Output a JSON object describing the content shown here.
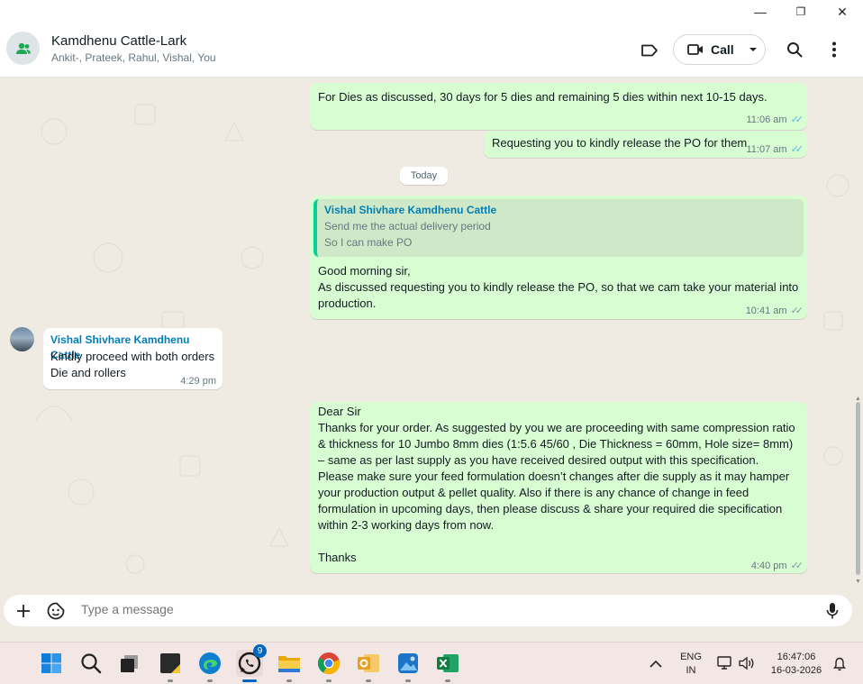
{
  "window": {
    "minimize_glyph": "—",
    "restore_glyph": "❐",
    "close_glyph": "✕"
  },
  "header": {
    "title": "Kamdhenu Cattle-Lark",
    "members": "Ankit-, Prateek, Rahul, Vishal, You",
    "call_label": "Call",
    "icons": [
      "group-icon",
      "label-icon",
      "video-icon",
      "search-icon",
      "more-icon"
    ]
  },
  "messages": [
    {
      "text": "For Dies as discussed, 30 days for 5 dies and remaining 5 dies within next 10-15 days.",
      "time": "11:06 am",
      "status": "read"
    },
    {
      "text": "Requesting you to kindly release the PO for them",
      "time": "11:07 am",
      "status": "read"
    },
    {
      "date_chip": "Today"
    },
    {
      "quote_author": "Vishal Shivhare Kamdhenu Cattle",
      "quote_line1": "Send me the actual delivery period",
      "quote_line2": "So I can make PO",
      "text": "Good morning sir,\nAs discussed requesting you to kindly release the PO, so  that we cam take your material into\nproduction.",
      "time": "10:41 am",
      "status": "delivered"
    },
    {
      "sender": "Vishal Shivhare Kamdhenu Cattle",
      "text": "Kindly proceed with both orders\nDie and rollers",
      "time": "4:29 pm"
    },
    {
      "text": "Dear Sir\nThanks for your order. As suggested by you we are proceeding with same compression ratio\n& thickness for 10 Jumbo 8mm dies (1:5.6   45/60 , Die Thickness =  60mm, Hole size= 8mm)\n– same as per last supply as you have received desired output with this specification.\nPlease make sure your feed formulation doesn’t changes after die supply as it may hamper\nyour production output & pellet quality. Also if there is any chance of change in feed\nformulation in upcoming days, then please discuss & share your required die specification\nwithin 2-3 working days from now.\n\nThanks",
      "time": "4:40 pm",
      "status": "delivered"
    }
  ],
  "composer": {
    "placeholder": "Type a message",
    "icons": [
      "plus-icon",
      "sticker-icon",
      "mic-icon"
    ]
  },
  "taskbar": {
    "whatsapp_badge": "9",
    "lang_line1": "ENG",
    "lang_line2": "IN",
    "clock_time": "16:47:06",
    "clock_date": "16-03-2026",
    "apps": [
      "start-icon",
      "search-icon",
      "task-view-icon",
      "sticky-notes-icon",
      "edge-icon",
      "whatsapp-icon",
      "file-explorer-icon",
      "chrome-icon",
      "outlook-icon",
      "photos-icon",
      "excel-icon"
    ]
  },
  "colors": {
    "outgoing_bubble": "#d9fdd3",
    "incoming_bubble": "#ffffff",
    "chat_background": "#efeae2",
    "read_ticks": "#53bdeb",
    "sender_name": "#027eb5"
  }
}
